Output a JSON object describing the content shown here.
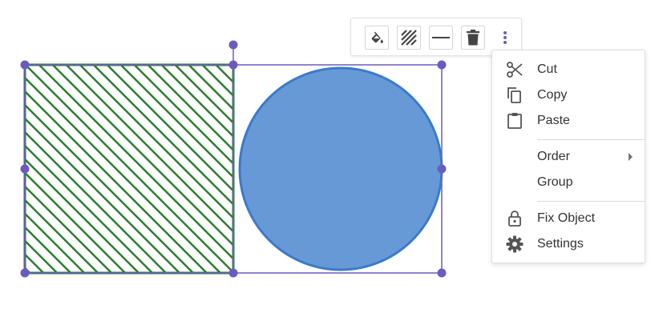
{
  "toolbar": {
    "buttons": [
      {
        "icon": "fill-color-icon"
      },
      {
        "icon": "hatch-pattern-icon"
      },
      {
        "icon": "line-style-icon"
      },
      {
        "icon": "delete-icon"
      }
    ],
    "more_icon": "more-vertical-icon"
  },
  "menu": {
    "items": [
      {
        "label": "Cut",
        "icon": "cut-icon"
      },
      {
        "label": "Copy",
        "icon": "copy-icon"
      },
      {
        "label": "Paste",
        "icon": "paste-icon"
      },
      {
        "label": "Order",
        "has_submenu": true
      },
      {
        "label": "Group"
      },
      {
        "label": "Fix Object",
        "icon": "lock-icon"
      },
      {
        "label": "Settings",
        "icon": "gear-icon"
      }
    ]
  },
  "colors": {
    "selection": "#6a5cbf",
    "hatch": "#2e7d32",
    "circle_fill": "#6699d6",
    "circle_stroke": "#3a7bc8",
    "icon": "#555555",
    "menu_text": "#333333"
  }
}
